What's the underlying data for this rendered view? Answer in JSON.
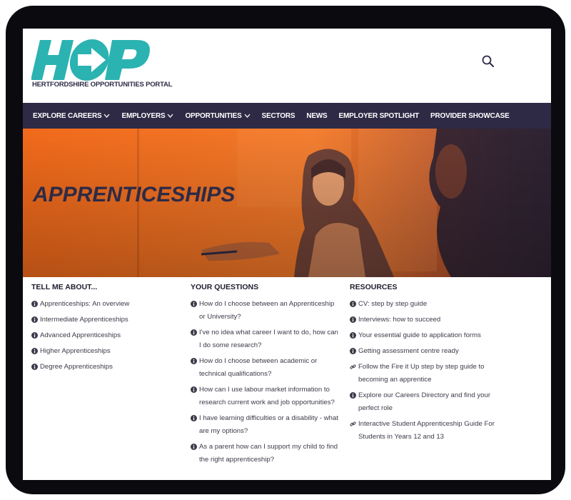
{
  "brand": {
    "logo_text": "HOP",
    "subtitle": "HERTFORDSHIRE OPPORTUNITIES PORTAL",
    "teal": "#2bb3b1",
    "navy": "#2e2a45",
    "orange": "#f26a1b"
  },
  "header": {
    "search_icon": "search-icon"
  },
  "nav": {
    "items": [
      {
        "label": "EXPLORE CAREERS",
        "dropdown": true
      },
      {
        "label": "EMPLOYERS",
        "dropdown": true
      },
      {
        "label": "OPPORTUNITIES",
        "dropdown": true
      },
      {
        "label": "SECTORS",
        "dropdown": false
      },
      {
        "label": "NEWS",
        "dropdown": false
      },
      {
        "label": "EMPLOYER SPOTLIGHT",
        "dropdown": false
      },
      {
        "label": "PROVIDER SHOWCASE",
        "dropdown": false
      }
    ]
  },
  "hero": {
    "title": "APPRENTICESHIPS"
  },
  "columns": {
    "tell_me": {
      "title": "TELL ME ABOUT...",
      "links": [
        {
          "text": "Apprenticeships: An overview",
          "icon": "info-icon"
        },
        {
          "text": "Intermediate Apprenticeships",
          "icon": "info-icon"
        },
        {
          "text": "Advanced Apprenticeships",
          "icon": "info-icon"
        },
        {
          "text": "Higher Apprenticeships",
          "icon": "info-icon"
        },
        {
          "text": "Degree Apprenticeships",
          "icon": "info-icon"
        }
      ]
    },
    "your_questions": {
      "title": "YOUR QUESTIONS",
      "links": [
        {
          "text": "How do I choose between an Apprenticeship or University?",
          "icon": "info-icon"
        },
        {
          "text": "I've no idea what career I want to do, how can I do some research?",
          "icon": "info-icon"
        },
        {
          "text": "How do I choose between academic or technical qualifications?",
          "icon": "info-icon"
        },
        {
          "text": "How can I use labour market information to research current work and job opportunities?",
          "icon": "info-icon"
        },
        {
          "text": "I have learning difficulties or a disability - what are my options?",
          "icon": "info-icon"
        },
        {
          "text": "As a parent how can I support my child to find the right apprenticeship?",
          "icon": "info-icon"
        }
      ]
    },
    "resources": {
      "title": "RESOURCES",
      "links": [
        {
          "text": "CV: step by step guide",
          "icon": "info-icon"
        },
        {
          "text": "Interviews: how to succeed",
          "icon": "info-icon"
        },
        {
          "text": "Your essential guide to application forms",
          "icon": "info-icon"
        },
        {
          "text": "Getting assessment centre ready",
          "icon": "info-icon"
        },
        {
          "text": "Follow the Fire it Up step by step guide to becoming an apprentice",
          "icon": "link-icon"
        },
        {
          "text": "Explore our Careers Directory and find your perfect role",
          "icon": "info-icon"
        },
        {
          "text": "Interactive Student Apprenticeship Guide For Students in Years 12 and 13",
          "icon": "link-icon"
        }
      ]
    }
  }
}
